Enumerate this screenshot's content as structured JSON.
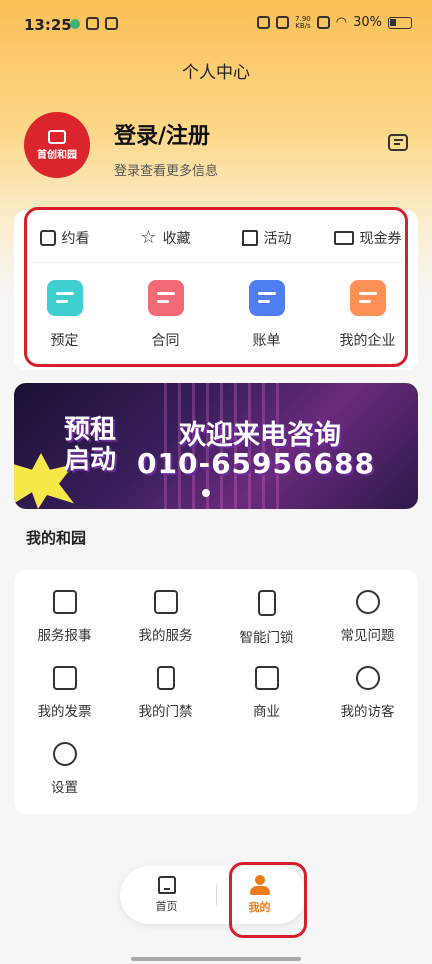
{
  "status_bar": {
    "time": "13:25",
    "speed_value": "7.90",
    "speed_unit": "KB/s",
    "battery": "30%"
  },
  "header": {
    "title": "个人中心"
  },
  "profile": {
    "logo_text": "首创和园",
    "login_title": "登录/注册",
    "login_sub": "登录查看更多信息",
    "message_icon": "message-icon"
  },
  "quick_links": [
    {
      "label": "约看",
      "icon": "calendar-check-icon"
    },
    {
      "label": "收藏",
      "icon": "star-icon"
    },
    {
      "label": "活动",
      "icon": "flag-icon"
    },
    {
      "label": "现金券",
      "icon": "coupon-icon"
    }
  ],
  "features": [
    {
      "label": "预定",
      "icon": "booking-icon",
      "color": "#3fcfcf"
    },
    {
      "label": "合同",
      "icon": "contract-icon",
      "color": "#f26a75"
    },
    {
      "label": "账单",
      "icon": "bill-icon",
      "color": "#4f7ef0"
    },
    {
      "label": "我的企业",
      "icon": "company-icon",
      "color": "#ff9055"
    }
  ],
  "banner": {
    "left_line1": "预租",
    "left_line2": "启动",
    "title": "欢迎来电咨询",
    "phone": "010-65956688"
  },
  "section_title": "我的和园",
  "services": [
    {
      "label": "服务报事",
      "icon": "tools-icon"
    },
    {
      "label": "我的服务",
      "icon": "service-doc-icon"
    },
    {
      "label": "智能门锁",
      "icon": "smart-lock-icon"
    },
    {
      "label": "常见问题",
      "icon": "question-icon"
    },
    {
      "label": "我的发票",
      "icon": "invoice-icon"
    },
    {
      "label": "我的门禁",
      "icon": "door-icon"
    },
    {
      "label": "商业",
      "icon": "shop-icon"
    },
    {
      "label": "我的访客",
      "icon": "visitor-icon"
    },
    {
      "label": "设置",
      "icon": "settings-icon"
    }
  ],
  "tabs": [
    {
      "label": "首页",
      "icon": "home-icon"
    },
    {
      "label": "我的",
      "icon": "profile-icon"
    }
  ],
  "colors": {
    "accent": "#f07a1a",
    "highlight_box": "#d81e2a"
  }
}
